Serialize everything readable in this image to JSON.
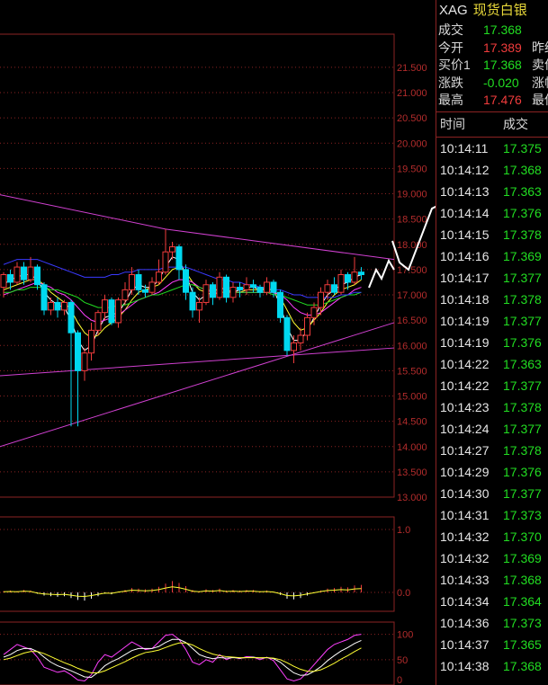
{
  "instrument": {
    "code": "XAG",
    "name": "现货白银"
  },
  "quote": [
    {
      "label": "成交",
      "value": "17.368",
      "color": "green",
      "extra": ""
    },
    {
      "label": "今开",
      "value": "17.389",
      "color": "red",
      "extra": "昨结"
    },
    {
      "label": "买价1",
      "value": "17.368",
      "color": "green",
      "extra": "卖价"
    },
    {
      "label": "涨跌",
      "value": "-0.020",
      "color": "green",
      "extra": "涨幅"
    },
    {
      "label": "最高",
      "value": "17.476",
      "color": "red",
      "extra": "最低"
    }
  ],
  "ticks_header": {
    "time": "时间",
    "price": "成交"
  },
  "ticks": [
    {
      "time": "10:14:11",
      "price": "17.375"
    },
    {
      "time": "10:14:12",
      "price": "17.368"
    },
    {
      "time": "10:14:13",
      "price": "17.363"
    },
    {
      "time": "10:14:14",
      "price": "17.376"
    },
    {
      "time": "10:14:15",
      "price": "17.378"
    },
    {
      "time": "10:14:16",
      "price": "17.369"
    },
    {
      "time": "10:14:17",
      "price": "17.377"
    },
    {
      "time": "10:14:18",
      "price": "17.378"
    },
    {
      "time": "10:14:19",
      "price": "17.377"
    },
    {
      "time": "10:14:19",
      "price": "17.376"
    },
    {
      "time": "10:14:22",
      "price": "17.363"
    },
    {
      "time": "10:14:22",
      "price": "17.377"
    },
    {
      "time": "10:14:23",
      "price": "17.378"
    },
    {
      "time": "10:14:24",
      "price": "17.377"
    },
    {
      "time": "10:14:27",
      "price": "17.378"
    },
    {
      "time": "10:14:29",
      "price": "17.376"
    },
    {
      "time": "10:14:30",
      "price": "17.377"
    },
    {
      "time": "10:14:31",
      "price": "17.373"
    },
    {
      "time": "10:14:32",
      "price": "17.370"
    },
    {
      "time": "10:14:32",
      "price": "17.369"
    },
    {
      "time": "10:14:33",
      "price": "17.368"
    },
    {
      "time": "10:14:34",
      "price": "17.364"
    },
    {
      "time": "10:14:36",
      "price": "17.373"
    },
    {
      "time": "10:14:37",
      "price": "17.365"
    },
    {
      "time": "10:14:38",
      "price": "17.368"
    }
  ],
  "colors": {
    "up": "#f03c3c",
    "down": "#00d8f0",
    "tick_price": "#22dd22",
    "border": "#8b2323"
  },
  "chart_data": [
    {
      "type": "candlestick",
      "title": "",
      "y_ticks": [
        "21.500",
        "21.000",
        "20.500",
        "20.000",
        "19.500",
        "19.000",
        "18.500",
        "18.000",
        "17.500",
        "17.000",
        "16.500",
        "16.000",
        "15.500",
        "15.000",
        "14.500",
        "14.000",
        "13.500",
        "13.000"
      ],
      "ylim": [
        13.0,
        21.8
      ],
      "candles": [
        [
          17.15,
          17.4,
          17.45,
          16.95
        ],
        [
          17.4,
          17.25,
          17.5,
          17.1
        ],
        [
          17.25,
          17.55,
          17.65,
          17.2
        ],
        [
          17.55,
          17.3,
          17.65,
          17.2
        ],
        [
          17.3,
          17.55,
          17.75,
          17.25
        ],
        [
          17.55,
          17.2,
          17.6,
          17.1
        ],
        [
          17.2,
          16.7,
          17.25,
          16.6
        ],
        [
          16.7,
          16.85,
          16.95,
          16.6
        ],
        [
          16.85,
          16.7,
          16.95,
          16.55
        ],
        [
          16.7,
          16.85,
          16.9,
          16.6
        ],
        [
          16.85,
          16.25,
          16.9,
          14.4
        ],
        [
          16.25,
          15.5,
          16.3,
          14.4
        ],
        [
          15.5,
          15.85,
          15.95,
          15.3
        ],
        [
          15.85,
          16.3,
          16.45,
          15.7
        ],
        [
          16.3,
          16.65,
          16.7,
          16.2
        ],
        [
          16.65,
          16.9,
          17.0,
          16.5
        ],
        [
          16.9,
          16.45,
          16.95,
          16.4
        ],
        [
          16.45,
          16.9,
          16.95,
          16.35
        ],
        [
          16.9,
          17.1,
          17.25,
          16.8
        ],
        [
          17.1,
          17.4,
          17.55,
          17.0
        ],
        [
          17.4,
          17.1,
          17.5,
          17.0
        ],
        [
          17.1,
          17.05,
          17.2,
          16.95
        ],
        [
          17.05,
          17.25,
          17.35,
          17.0
        ],
        [
          17.25,
          17.45,
          17.7,
          17.2
        ],
        [
          17.45,
          17.85,
          18.3,
          17.4
        ],
        [
          17.85,
          17.95,
          18.05,
          17.7
        ],
        [
          17.95,
          17.5,
          18.0,
          17.3
        ],
        [
          17.5,
          17.05,
          17.6,
          16.9
        ],
        [
          17.05,
          16.7,
          17.15,
          16.55
        ],
        [
          16.7,
          16.85,
          16.95,
          16.45
        ],
        [
          16.85,
          17.2,
          17.3,
          16.8
        ],
        [
          17.2,
          16.95,
          17.25,
          16.8
        ],
        [
          16.95,
          17.35,
          17.45,
          16.9
        ],
        [
          17.35,
          16.95,
          17.4,
          16.85
        ],
        [
          16.95,
          17.15,
          17.25,
          16.85
        ],
        [
          17.15,
          17.1,
          17.25,
          16.95
        ],
        [
          17.1,
          17.2,
          17.35,
          17.0
        ],
        [
          17.2,
          17.15,
          17.3,
          17.05
        ],
        [
          17.15,
          17.05,
          17.2,
          16.95
        ],
        [
          17.05,
          17.25,
          17.35,
          17.0
        ],
        [
          17.25,
          17.05,
          17.3,
          16.95
        ],
        [
          17.05,
          16.55,
          17.1,
          16.45
        ],
        [
          16.55,
          15.9,
          16.6,
          15.8
        ],
        [
          15.9,
          16.05,
          16.2,
          15.65
        ],
        [
          16.05,
          16.2,
          16.35,
          15.9
        ],
        [
          16.2,
          16.55,
          16.65,
          16.1
        ],
        [
          16.55,
          16.75,
          16.85,
          16.4
        ],
        [
          16.75,
          17.05,
          17.15,
          16.6
        ],
        [
          17.05,
          17.2,
          17.3,
          16.9
        ],
        [
          17.2,
          17.05,
          17.35,
          17.0
        ],
        [
          17.05,
          17.4,
          17.5,
          17.0
        ],
        [
          17.4,
          17.25,
          17.45,
          17.1
        ],
        [
          17.25,
          17.45,
          17.75,
          17.2
        ],
        [
          17.45,
          17.4,
          17.55,
          17.3
        ]
      ],
      "ma_lines": [
        {
          "color": "#ffffff",
          "values": [
            17.2,
            17.3,
            17.35,
            17.4,
            17.4,
            17.3,
            17.05,
            16.9,
            16.8,
            16.75,
            16.5,
            16.1,
            15.9,
            16.0,
            16.3,
            16.55,
            16.6,
            16.65,
            16.85,
            17.1,
            17.2,
            17.15,
            17.15,
            17.3,
            17.55,
            17.75,
            17.7,
            17.4,
            17.05,
            16.9,
            17.0,
            17.05,
            17.15,
            17.1,
            17.05,
            17.1,
            17.15,
            17.15,
            17.1,
            17.15,
            17.1,
            16.8,
            16.35,
            16.1,
            16.1,
            16.3,
            16.55,
            16.8,
            17.0,
            17.1,
            17.2,
            17.25,
            17.35,
            17.4
          ]
        },
        {
          "color": "#ffff33",
          "values": [
            17.1,
            17.15,
            17.2,
            17.25,
            17.3,
            17.3,
            17.2,
            17.05,
            16.95,
            16.85,
            16.7,
            16.45,
            16.25,
            16.15,
            16.2,
            16.35,
            16.45,
            16.55,
            16.7,
            16.9,
            17.05,
            17.1,
            17.15,
            17.2,
            17.35,
            17.5,
            17.55,
            17.45,
            17.25,
            17.1,
            17.05,
            17.0,
            17.05,
            17.05,
            17.05,
            17.05,
            17.1,
            17.1,
            17.1,
            17.1,
            17.1,
            16.95,
            16.7,
            16.45,
            16.3,
            16.35,
            16.5,
            16.65,
            16.85,
            17.0,
            17.1,
            17.15,
            17.2,
            17.3
          ]
        },
        {
          "color": "#ff40ff",
          "values": [
            17.0,
            17.05,
            17.1,
            17.15,
            17.2,
            17.25,
            17.2,
            17.15,
            17.05,
            17.0,
            16.9,
            16.75,
            16.6,
            16.5,
            16.45,
            16.5,
            16.55,
            16.6,
            16.7,
            16.8,
            16.9,
            16.95,
            17.0,
            17.05,
            17.15,
            17.25,
            17.3,
            17.3,
            17.25,
            17.15,
            17.1,
            17.05,
            17.05,
            17.05,
            17.05,
            17.05,
            17.05,
            17.05,
            17.05,
            17.05,
            17.05,
            17.0,
            16.9,
            16.75,
            16.65,
            16.6,
            16.6,
            16.65,
            16.75,
            16.85,
            16.95,
            17.0,
            17.1,
            17.15
          ]
        },
        {
          "color": "#22dd22",
          "values": [
            17.05,
            17.05,
            17.1,
            17.1,
            17.15,
            17.15,
            17.15,
            17.1,
            17.1,
            17.05,
            17.0,
            16.95,
            16.85,
            16.8,
            16.75,
            16.75,
            16.75,
            16.8,
            16.8,
            16.85,
            16.9,
            16.95,
            17.0,
            17.0,
            17.05,
            17.1,
            17.15,
            17.2,
            17.2,
            17.15,
            17.1,
            17.1,
            17.05,
            17.05,
            17.05,
            17.05,
            17.05,
            17.05,
            17.05,
            17.05,
            17.0,
            17.0,
            16.95,
            16.9,
            16.85,
            16.8,
            16.8,
            16.8,
            16.85,
            16.9,
            16.95,
            17.0,
            17.0,
            17.05
          ]
        },
        {
          "color": "#3a3aff",
          "values": [
            17.6,
            17.65,
            17.7,
            17.7,
            17.7,
            17.7,
            17.65,
            17.6,
            17.55,
            17.5,
            17.45,
            17.4,
            17.35,
            17.35,
            17.35,
            17.35,
            17.4,
            17.4,
            17.45,
            17.45,
            17.5,
            17.5,
            17.5,
            17.5,
            17.55,
            17.55,
            17.55,
            17.55,
            17.5,
            17.45,
            17.4,
            17.35,
            17.3,
            17.3,
            17.25,
            17.25,
            17.2,
            17.2,
            17.15,
            17.15,
            17.1,
            17.1,
            17.05,
            17.0,
            17.0,
            16.95,
            16.95,
            16.95,
            16.95,
            16.95,
            17.0,
            17.0,
            17.05,
            17.05
          ]
        }
      ]
    },
    {
      "type": "bar",
      "title": "",
      "y_ticks": [
        "1.0",
        "0.0"
      ],
      "ylim": [
        -0.3,
        1.2
      ],
      "values": [
        0.02,
        0.03,
        0.02,
        0.04,
        0.03,
        -0.02,
        -0.05,
        -0.06,
        -0.07,
        -0.06,
        -0.09,
        -0.12,
        -0.13,
        -0.1,
        -0.06,
        -0.02,
        -0.03,
        0.01,
        0.04,
        0.07,
        0.06,
        0.05,
        0.06,
        0.09,
        0.14,
        0.18,
        0.15,
        0.1,
        0.04,
        0.02,
        0.05,
        0.04,
        0.06,
        0.03,
        0.04,
        0.03,
        0.04,
        0.04,
        0.02,
        0.03,
        0.01,
        -0.04,
        -0.1,
        -0.11,
        -0.09,
        -0.05,
        -0.01,
        0.03,
        0.06,
        0.07,
        0.09,
        0.08,
        0.11,
        0.12
      ]
    },
    {
      "type": "line",
      "title": "",
      "y_ticks": [
        "100",
        "50",
        "0"
      ],
      "ylim": [
        0,
        110
      ],
      "series": [
        {
          "color": "#ff40ff",
          "values": [
            60,
            70,
            80,
            75,
            70,
            55,
            35,
            30,
            25,
            28,
            20,
            10,
            8,
            20,
            45,
            60,
            55,
            65,
            75,
            85,
            78,
            70,
            72,
            85,
            98,
            100,
            90,
            70,
            45,
            40,
            50,
            45,
            60,
            50,
            55,
            52,
            56,
            55,
            50,
            55,
            48,
            30,
            12,
            8,
            12,
            25,
            40,
            55,
            70,
            80,
            85,
            90,
            98,
            100
          ]
        },
        {
          "color": "#ffffff",
          "values": [
            55,
            60,
            68,
            72,
            72,
            66,
            55,
            45,
            38,
            33,
            28,
            22,
            16,
            15,
            25,
            38,
            46,
            52,
            60,
            68,
            72,
            72,
            72,
            76,
            84,
            90,
            90,
            84,
            72,
            60,
            55,
            52,
            54,
            53,
            54,
            53,
            54,
            55,
            53,
            54,
            52,
            45,
            34,
            24,
            19,
            20,
            27,
            36,
            48,
            58,
            67,
            74,
            82,
            88
          ]
        },
        {
          "color": "#ffff33",
          "values": [
            50,
            53,
            58,
            63,
            66,
            66,
            62,
            56,
            50,
            44,
            39,
            33,
            28,
            24,
            24,
            28,
            34,
            40,
            46,
            53,
            59,
            64,
            66,
            69,
            74,
            79,
            83,
            83,
            79,
            72,
            66,
            61,
            58,
            56,
            55,
            54,
            54,
            54,
            54,
            54,
            53,
            50,
            44,
            37,
            31,
            27,
            27,
            30,
            36,
            43,
            51,
            58,
            66,
            73
          ]
        }
      ]
    }
  ]
}
